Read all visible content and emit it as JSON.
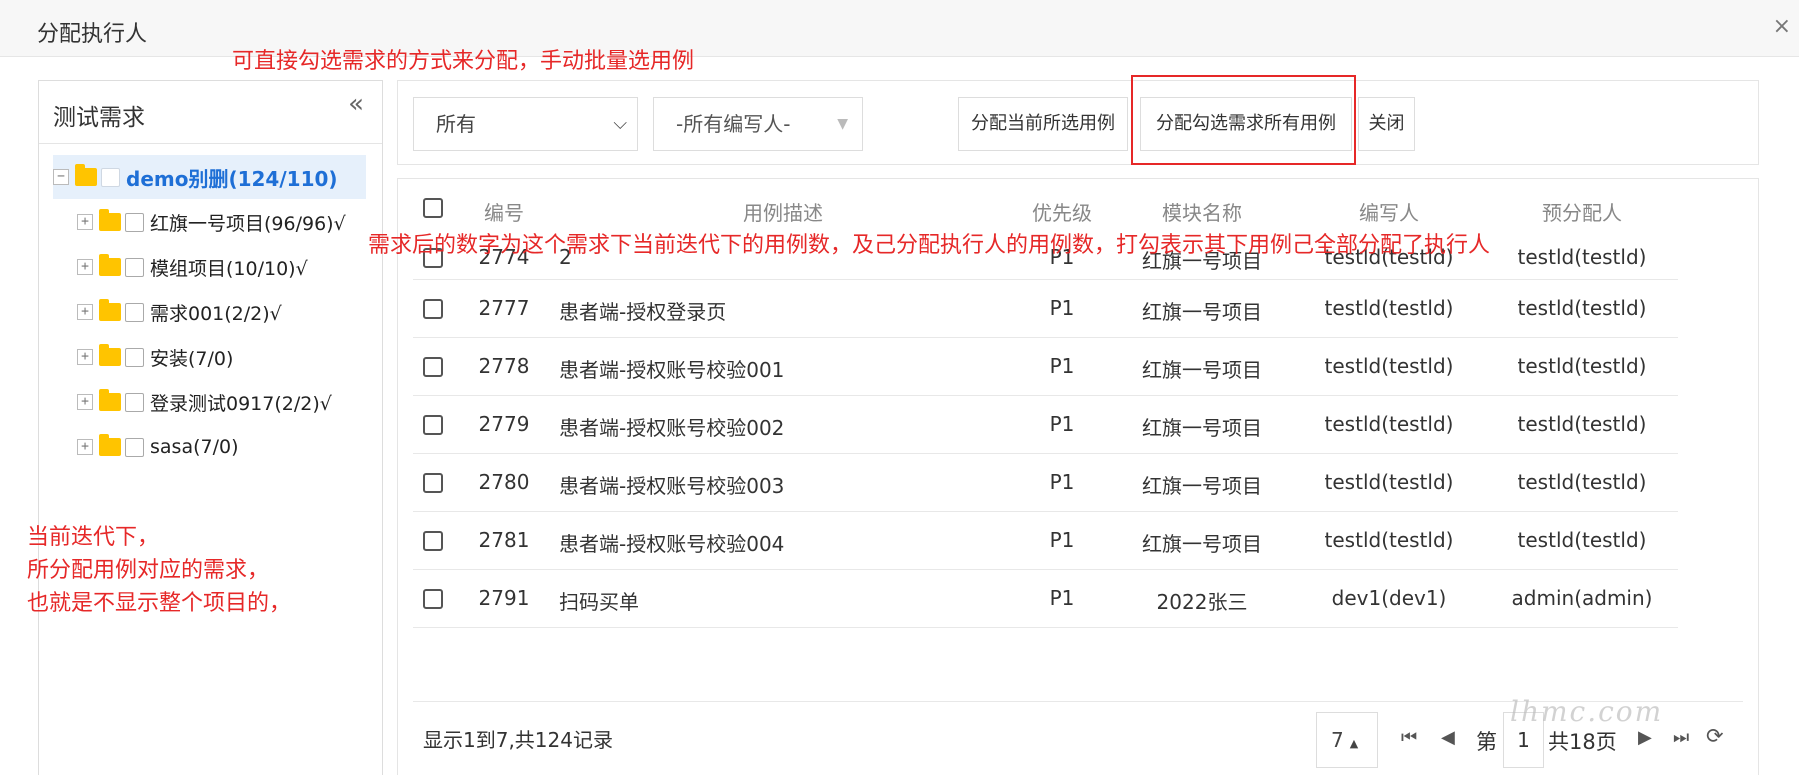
{
  "dialog": {
    "title": "分配执行人",
    "close_glyph": "×"
  },
  "annotations": {
    "top": "可直接勾选需求的方式来分配，手动批量选用例",
    "middle": "需求后的数字为这个需求下当前迭代下的用例数，及己分配执行人的用例数，打勾表示其下用例己全部分配了执行人",
    "left_lines": [
      "当前迭代下，",
      "所分配用例对应的需求，",
      "也就是不显示整个项目的，"
    ]
  },
  "left_panel": {
    "title": "测试需求",
    "collapse_glyph": "«",
    "root": {
      "label": "demo别删(124/110)",
      "expander": "−"
    },
    "children": [
      {
        "label": "红旗一号项目(96/96)√",
        "expander": "+"
      },
      {
        "label": "模组项目(10/10)√",
        "expander": "+"
      },
      {
        "label": "需求001(2/2)√",
        "expander": "+"
      },
      {
        "label": "安装(7/0)",
        "expander": "+"
      },
      {
        "label": "登录测试0917(2/2)√",
        "expander": "+"
      },
      {
        "label": "sasa(7/0)",
        "expander": "+"
      }
    ]
  },
  "toolbar": {
    "filter_select": {
      "value": "所有",
      "arrow": "⌵"
    },
    "author_select": {
      "value": "-所有编写人-",
      "arrow": "▼"
    },
    "assign_selected_label": "分配当前所选用例",
    "assign_checked_label": "分配勾选需求所有用例",
    "close_label": "关闭"
  },
  "table": {
    "headers": [
      "编号",
      "用例描述",
      "优先级",
      "模块名称",
      "编写人",
      "预分配人"
    ],
    "rows": [
      [
        "2774",
        "2",
        "P1",
        "红旗一号项目",
        "testld(testld)",
        "testld(testld)"
      ],
      [
        "2777",
        "患者端-授权登录页",
        "P1",
        "红旗一号项目",
        "testld(testld)",
        "testld(testld)"
      ],
      [
        "2778",
        "患者端-授权账号校验001",
        "P1",
        "红旗一号项目",
        "testld(testld)",
        "testld(testld)"
      ],
      [
        "2779",
        "患者端-授权账号校验002",
        "P1",
        "红旗一号项目",
        "testld(testld)",
        "testld(testld)"
      ],
      [
        "2780",
        "患者端-授权账号校验003",
        "P1",
        "红旗一号项目",
        "testld(testld)",
        "testld(testld)"
      ],
      [
        "2781",
        "患者端-授权账号校验004",
        "P1",
        "红旗一号项目",
        "testld(testld)",
        "testld(testld)"
      ],
      [
        "2791",
        "扫码买单",
        "P1",
        "2022张三",
        "dev1(dev1)",
        "admin(admin)"
      ]
    ]
  },
  "pagination": {
    "summary": "显示1到7,共124记录",
    "page_size": "7",
    "page_size_arrow": "▲",
    "first_glyph": "⏮",
    "prev_glyph": "◀",
    "page_prefix": "第",
    "page_value": "1",
    "total_pages": "共18页",
    "next_glyph": "▶",
    "last_glyph": "⏭",
    "refresh_glyph": "⟳"
  },
  "watermark": "lhmc.com"
}
